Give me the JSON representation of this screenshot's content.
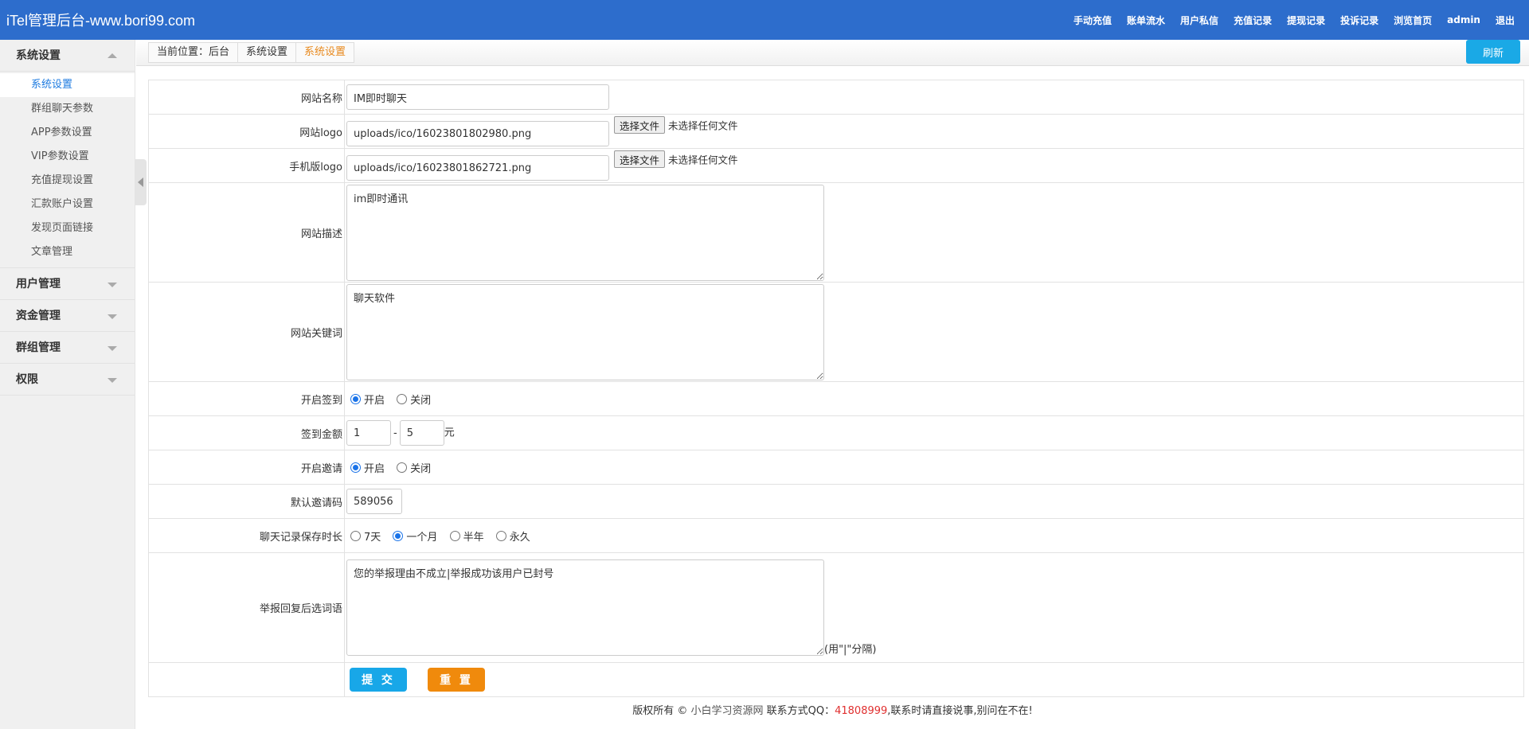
{
  "header": {
    "brand": "iTel管理后台-www.bori99.com",
    "nav": [
      "手动充值",
      "账单流水",
      "用户私信",
      "充值记录",
      "提现记录",
      "投诉记录",
      "浏览首页",
      "admin",
      "退出"
    ]
  },
  "sidebar": {
    "groups": [
      {
        "label": "系统设置",
        "expanded": true
      },
      {
        "label": "用户管理",
        "expanded": false
      },
      {
        "label": "资金管理",
        "expanded": false
      },
      {
        "label": "群组管理",
        "expanded": false
      },
      {
        "label": "权限",
        "expanded": false
      }
    ],
    "items": [
      "系统设置",
      "群组聊天参数",
      "APP参数设置",
      "VIP参数设置",
      "充值提现设置",
      "汇款账户设置",
      "发现页面链接",
      "文章管理"
    ],
    "active_item": "系统设置"
  },
  "breadcrumb": {
    "items": [
      "当前位置：后台",
      "系统设置",
      "系统设置"
    ],
    "refresh_label": "刷新"
  },
  "form": {
    "site_name": {
      "label": "网站名称",
      "value": "IM即时聊天"
    },
    "site_logo": {
      "label": "网站logo",
      "value": "uploads/ico/16023801802980.png",
      "file_button": "选择文件",
      "file_status": "未选择任何文件"
    },
    "mobile_logo": {
      "label": "手机版logo",
      "value": "uploads/ico/16023801862721.png",
      "file_button": "选择文件",
      "file_status": "未选择任何文件"
    },
    "site_desc": {
      "label": "网站描述",
      "value": "im即时通讯"
    },
    "site_keywords": {
      "label": "网站关键词",
      "value": "聊天软件"
    },
    "checkin_enabled": {
      "label": "开启签到",
      "options": [
        "开启",
        "关闭"
      ],
      "selected": "开启"
    },
    "checkin_amount": {
      "label": "签到金额",
      "min": "1",
      "separator": "-",
      "max": "5",
      "unit": "元"
    },
    "invite_enabled": {
      "label": "开启邀请",
      "options": [
        "开启",
        "关闭"
      ],
      "selected": "开启"
    },
    "default_invite_code": {
      "label": "默认邀请码",
      "value": "589056"
    },
    "chat_retention": {
      "label": "聊天记录保存时长",
      "options": [
        "7天",
        "一个月",
        "半年",
        "永久"
      ],
      "selected": "一个月"
    },
    "report_reply": {
      "label": "举报回复后选词语",
      "value": "您的举报理由不成立|举报成功该用户已封号",
      "hint": "(用\"|\"分隔)"
    },
    "submit_label": "提 交",
    "reset_label": "重 置"
  },
  "footer": {
    "prefix": "版权所有 © ",
    "site_link": "小白学习资源网",
    "contact": " 联系方式QQ：",
    "qq": "41808999",
    "suffix": ",联系时请直接说事,别问在不在!"
  },
  "colors": {
    "topbar": "#2d6dcc",
    "active_link": "#1e7be0",
    "crumb_current": "#e8891d",
    "refresh": "#1aa9e6",
    "submit": "#18a7e8",
    "reset": "#f08a0c",
    "qq": "#e03030"
  }
}
